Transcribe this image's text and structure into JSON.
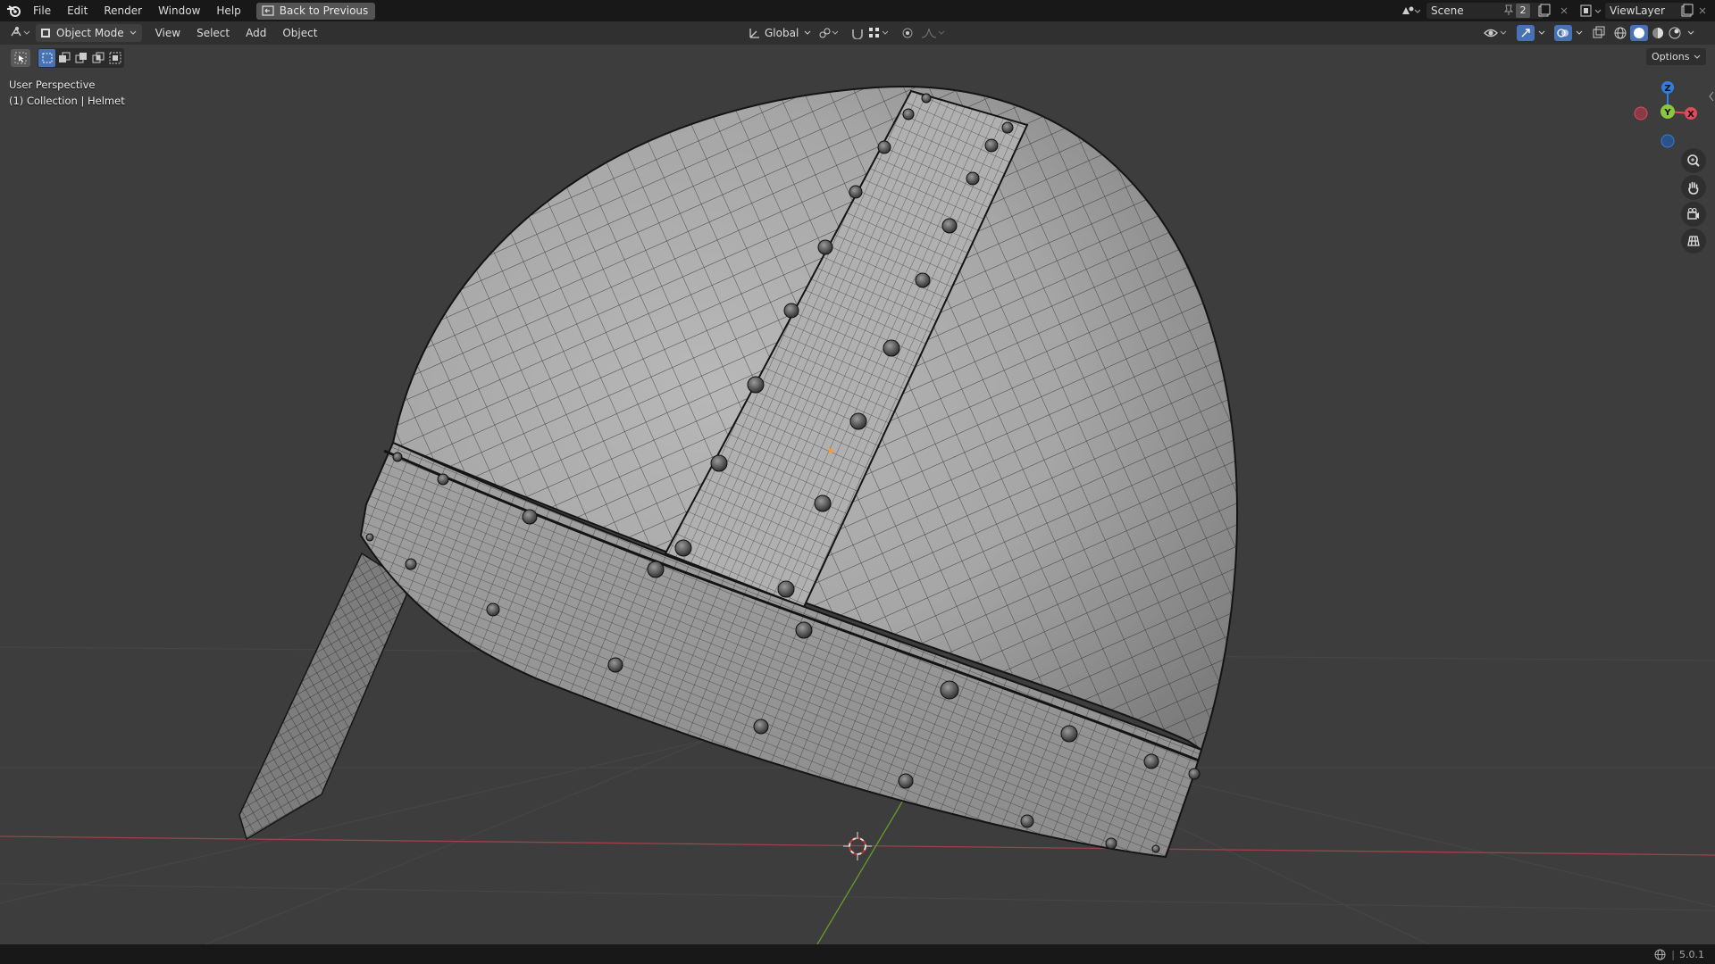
{
  "menubar": {
    "items": [
      "File",
      "Edit",
      "Render",
      "Window",
      "Help"
    ],
    "back_button": "Back to Previous"
  },
  "scene": {
    "name": "Scene",
    "count": "2",
    "view_layer": "ViewLayer"
  },
  "header": {
    "mode": "Object Mode",
    "menus": [
      "View",
      "Select",
      "Add",
      "Object"
    ],
    "transform_orientation": "Global",
    "options": "Options"
  },
  "viewport": {
    "perspective": "User Perspective",
    "collection_info": "(1) Collection | Helmet",
    "axes": {
      "z": "Z",
      "y": "Y",
      "x": "X"
    }
  },
  "status": {
    "version": "5.0.1"
  },
  "colors": {
    "accent": "#4772b3",
    "x_axis": "#e04b5a",
    "y_axis": "#8cc63f",
    "z_axis": "#2f7fe0",
    "background": "#3d3d3d",
    "topbar": "#181818"
  }
}
